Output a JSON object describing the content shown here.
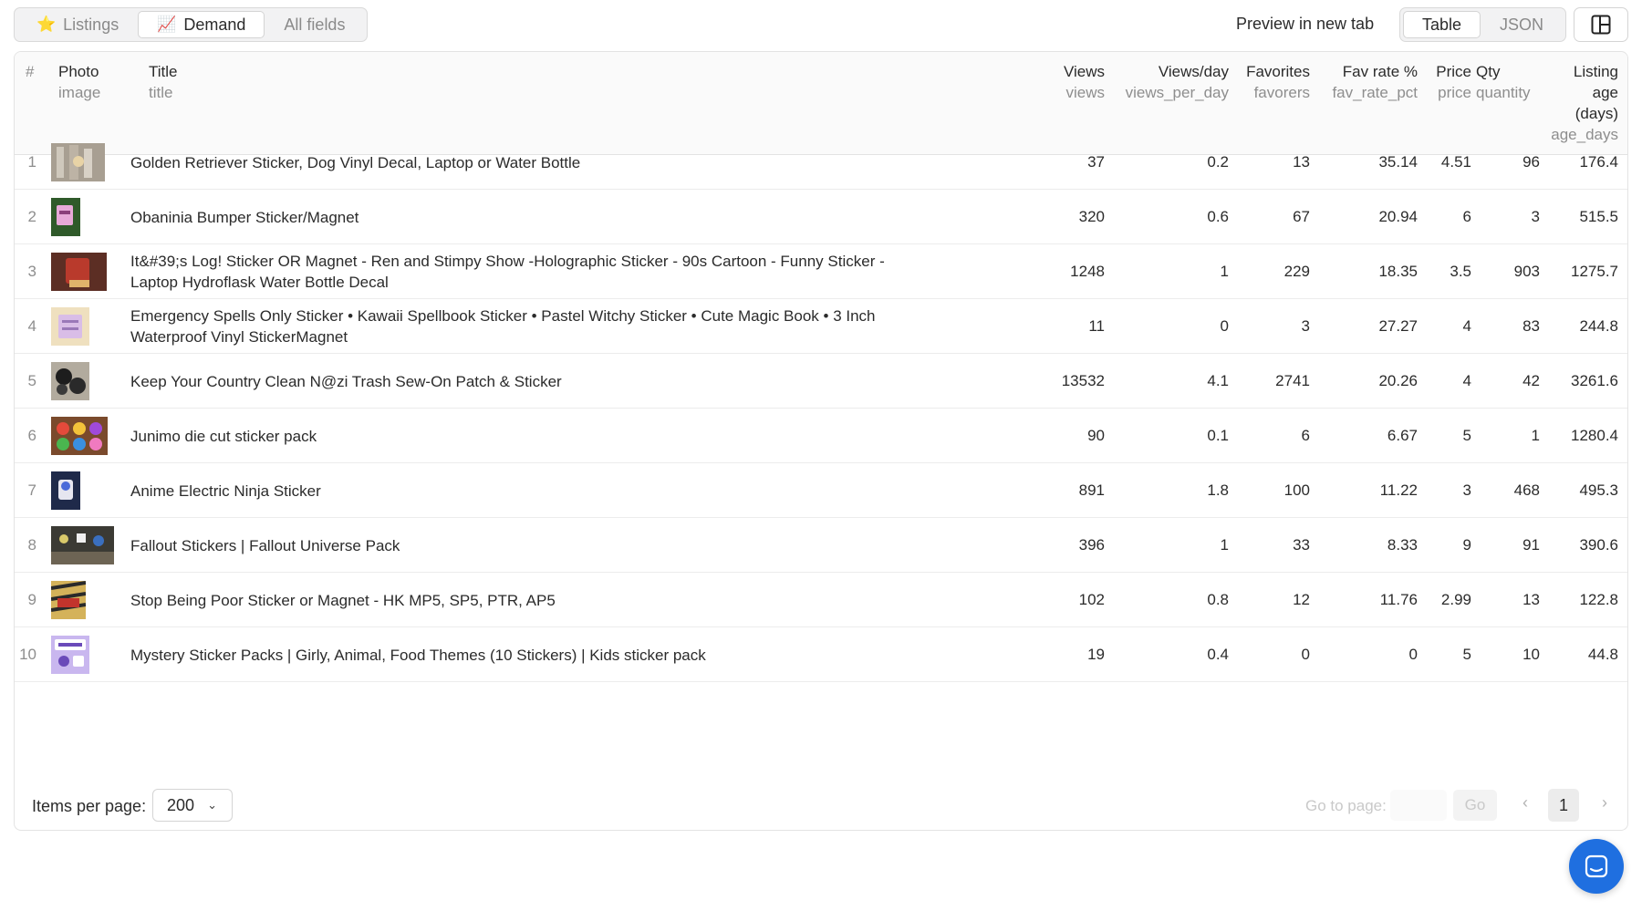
{
  "toolbar": {
    "tabs": [
      {
        "icon": "star-icon",
        "glyph": "⭐",
        "label": "Listings",
        "active": false
      },
      {
        "icon": "chart-increasing-icon",
        "glyph": "📈",
        "label": "Demand",
        "active": true
      },
      {
        "icon": "",
        "glyph": "",
        "label": "All fields",
        "active": false
      }
    ],
    "preview_label": "Preview in new tab",
    "view_toggle": [
      {
        "label": "Table",
        "active": true
      },
      {
        "label": "JSON",
        "active": false
      }
    ]
  },
  "table": {
    "columns": [
      {
        "label": "#",
        "key": ""
      },
      {
        "label": "Photo",
        "key": "image"
      },
      {
        "label": "Title",
        "key": "title"
      },
      {
        "label": "Views",
        "key": "views"
      },
      {
        "label": "Views/day",
        "key": "views_per_day"
      },
      {
        "label": "Favorites",
        "key": "favorers"
      },
      {
        "label": "Fav rate %",
        "key": "fav_rate_pct"
      },
      {
        "label": "Price",
        "key": "price"
      },
      {
        "label": "Qty",
        "key": "quantity"
      },
      {
        "label": "Listing age (days)",
        "key": "age_days"
      }
    ],
    "rows": [
      {
        "idx": "1",
        "title": "Golden Retriever Sticker, Dog Vinyl Decal, Laptop or Water Bottle",
        "views": "37",
        "views_per_day": "0.2",
        "favorers": "13",
        "fav_rate_pct": "35.14",
        "price": "4.51",
        "quantity": "96",
        "age_days": "176.4"
      },
      {
        "idx": "2",
        "title": "Obaninia Bumper Sticker/Magnet",
        "views": "320",
        "views_per_day": "0.6",
        "favorers": "67",
        "fav_rate_pct": "20.94",
        "price": "6",
        "quantity": "3",
        "age_days": "515.5"
      },
      {
        "idx": "3",
        "title": "It&#39;s Log! Sticker OR Magnet - Ren and Stimpy Show -Holographic Sticker - 90s Cartoon - Funny Sticker - Laptop Hydroflask Water Bottle Decal",
        "views": "1248",
        "views_per_day": "1",
        "favorers": "229",
        "fav_rate_pct": "18.35",
        "price": "3.5",
        "quantity": "903",
        "age_days": "1275.7"
      },
      {
        "idx": "4",
        "title": "Emergency Spells Only Sticker • Kawaii Spellbook Sticker • Pastel Witchy Sticker • Cute Magic Book • 3 Inch Waterproof Vinyl StickerMagnet",
        "views": "11",
        "views_per_day": "0",
        "favorers": "3",
        "fav_rate_pct": "27.27",
        "price": "4",
        "quantity": "83",
        "age_days": "244.8"
      },
      {
        "idx": "5",
        "title": "Keep Your Country Clean N@zi Trash Sew-On Patch & Sticker",
        "views": "13532",
        "views_per_day": "4.1",
        "favorers": "2741",
        "fav_rate_pct": "20.26",
        "price": "4",
        "quantity": "42",
        "age_days": "3261.6"
      },
      {
        "idx": "6",
        "title": "Junimo die cut sticker pack",
        "views": "90",
        "views_per_day": "0.1",
        "favorers": "6",
        "fav_rate_pct": "6.67",
        "price": "5",
        "quantity": "1",
        "age_days": "1280.4"
      },
      {
        "idx": "7",
        "title": "Anime Electric Ninja Sticker",
        "views": "891",
        "views_per_day": "1.8",
        "favorers": "100",
        "fav_rate_pct": "11.22",
        "price": "3",
        "quantity": "468",
        "age_days": "495.3"
      },
      {
        "idx": "8",
        "title": "Fallout Stickers | Fallout Universe Pack",
        "views": "396",
        "views_per_day": "1",
        "favorers": "33",
        "fav_rate_pct": "8.33",
        "price": "9",
        "quantity": "91",
        "age_days": "390.6"
      },
      {
        "idx": "9",
        "title": "Stop Being Poor Sticker or Magnet - HK MP5, SP5, PTR, AP5",
        "views": "102",
        "views_per_day": "0.8",
        "favorers": "12",
        "fav_rate_pct": "11.76",
        "price": "2.99",
        "quantity": "13",
        "age_days": "122.8"
      },
      {
        "idx": "10",
        "title": "Mystery Sticker Packs | Girly, Animal, Food Themes (10 Stickers) | Kids sticker pack",
        "views": "19",
        "views_per_day": "0.4",
        "favorers": "0",
        "fav_rate_pct": "0",
        "price": "5",
        "quantity": "10",
        "age_days": "44.8"
      }
    ]
  },
  "footer": {
    "items_per_page_label": "Items per page:",
    "items_per_page_value": "200",
    "goto_label": "Go to page:",
    "go_label": "Go",
    "current_page": "1"
  },
  "colors": {
    "accent_blue": "#1f6fe0",
    "header_bg": "#fafafa",
    "border": "#e3e3e3"
  }
}
